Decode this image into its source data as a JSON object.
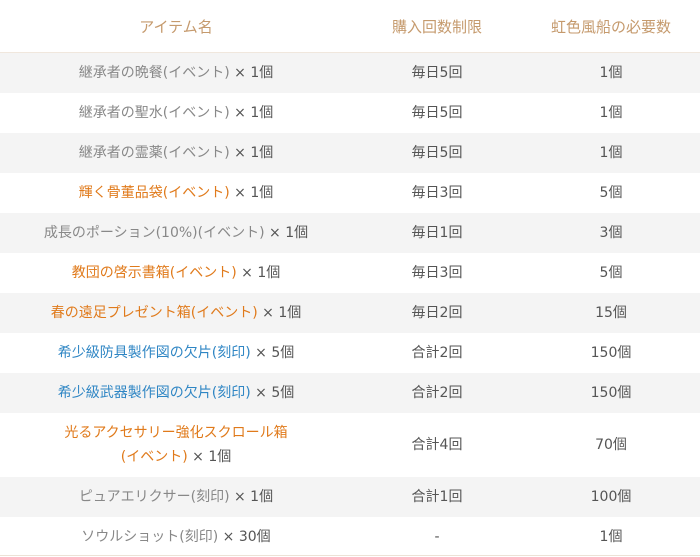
{
  "header": {
    "col_item": "アイテム名",
    "col_limit": "購入回数制限",
    "col_cost": "虹色風船の必要数"
  },
  "rows": [
    {
      "name": "継承者の晩餐(イベント)",
      "qty": " × 1個",
      "limit": "毎日5回",
      "cost": "1個"
    },
    {
      "name": "継承者の聖水(イベント)",
      "qty": " × 1個",
      "limit": "毎日5回",
      "cost": "1個"
    },
    {
      "name": "継承者の霊薬(イベント)",
      "qty": " × 1個",
      "limit": "毎日5回",
      "cost": "1個"
    },
    {
      "name": "輝く骨董品袋(イベント)",
      "qty": " × 1個",
      "limit": "毎日3回",
      "cost": "5個"
    },
    {
      "name": "成長のポーション(10%)(イベント)",
      "qty": " × 1個",
      "limit": "毎日1回",
      "cost": "3個"
    },
    {
      "name": "教団の啓示書箱(イベント)",
      "qty": " × 1個",
      "limit": "毎日3回",
      "cost": "5個"
    },
    {
      "name": "春の遠足プレゼント箱(イベント)",
      "qty": " × 1個",
      "limit": "毎日2回",
      "cost": "15個"
    },
    {
      "name": "希少級防具製作図の欠片(刻印)",
      "qty": " × 5個",
      "limit": "合計2回",
      "cost": "150個"
    },
    {
      "name": "希少級武器製作図の欠片(刻印)",
      "qty": " × 5個",
      "limit": "合計2回",
      "cost": "150個"
    },
    {
      "name_line1": "光るアクセサリー強化スクロール箱",
      "name_line2": "(イベント)",
      "qty": " × 1個",
      "limit": "合計4回",
      "cost": "70個"
    },
    {
      "name": "ピュアエリクサー(刻印)",
      "qty": " × 1個",
      "limit": "合計1回",
      "cost": "100個"
    },
    {
      "name": "ソウルショット(刻印)",
      "qty": " × 30個",
      "limit": "-",
      "cost": "1個"
    }
  ],
  "colors": {
    "header_text": "#c59a6d",
    "gray_item": "#888888",
    "orange_item": "#e07a1b",
    "blue_item": "#2f86c4",
    "stripe": "#f4f4f4"
  }
}
